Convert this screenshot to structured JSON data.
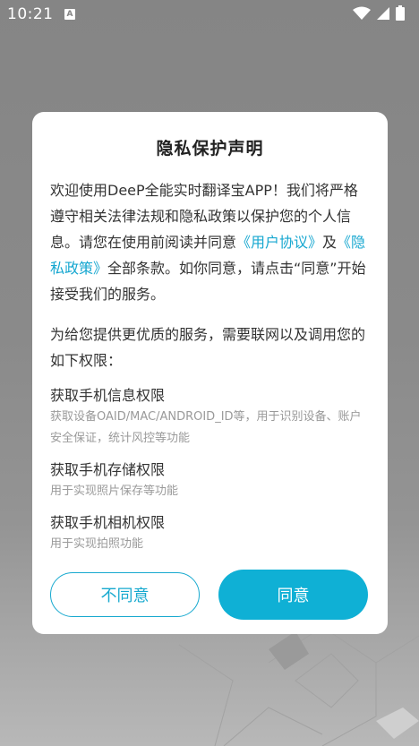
{
  "status_bar": {
    "time": "10:21",
    "notification_icon_letter": "A"
  },
  "dialog": {
    "title": "隐私保护声明",
    "intro_part1": "欢迎使用DeeP全能实时翻译宝APP！我们将严格遵守相关法律法规和隐私政策以保护您的个人信息。请您在使用前阅读并同意",
    "user_agreement_link": "《用户协议》",
    "and_text": "及",
    "privacy_policy_link": "《隐私政策》",
    "intro_part2": "全部条款。如你同意，请点击“同意”开始接受我们的服务。",
    "permissions_intro": "为给您提供更优质的服务，需要联网以及调用您的如下权限：",
    "permissions": [
      {
        "title": "获取手机信息权限",
        "desc": "获取设备OAID/MAC/ANDROID_ID等，用于识别设备、账户安全保证，统计风控等功能"
      },
      {
        "title": "获取手机存储权限",
        "desc": "用于实现照片保存等功能"
      },
      {
        "title": "获取手机相机权限",
        "desc": "用于实现拍照功能"
      }
    ],
    "disagree_label": "不同意",
    "agree_label": "同意"
  },
  "colors": {
    "accent": "#0fb0d5",
    "link": "#16a7d0",
    "overlay": "#858585"
  }
}
